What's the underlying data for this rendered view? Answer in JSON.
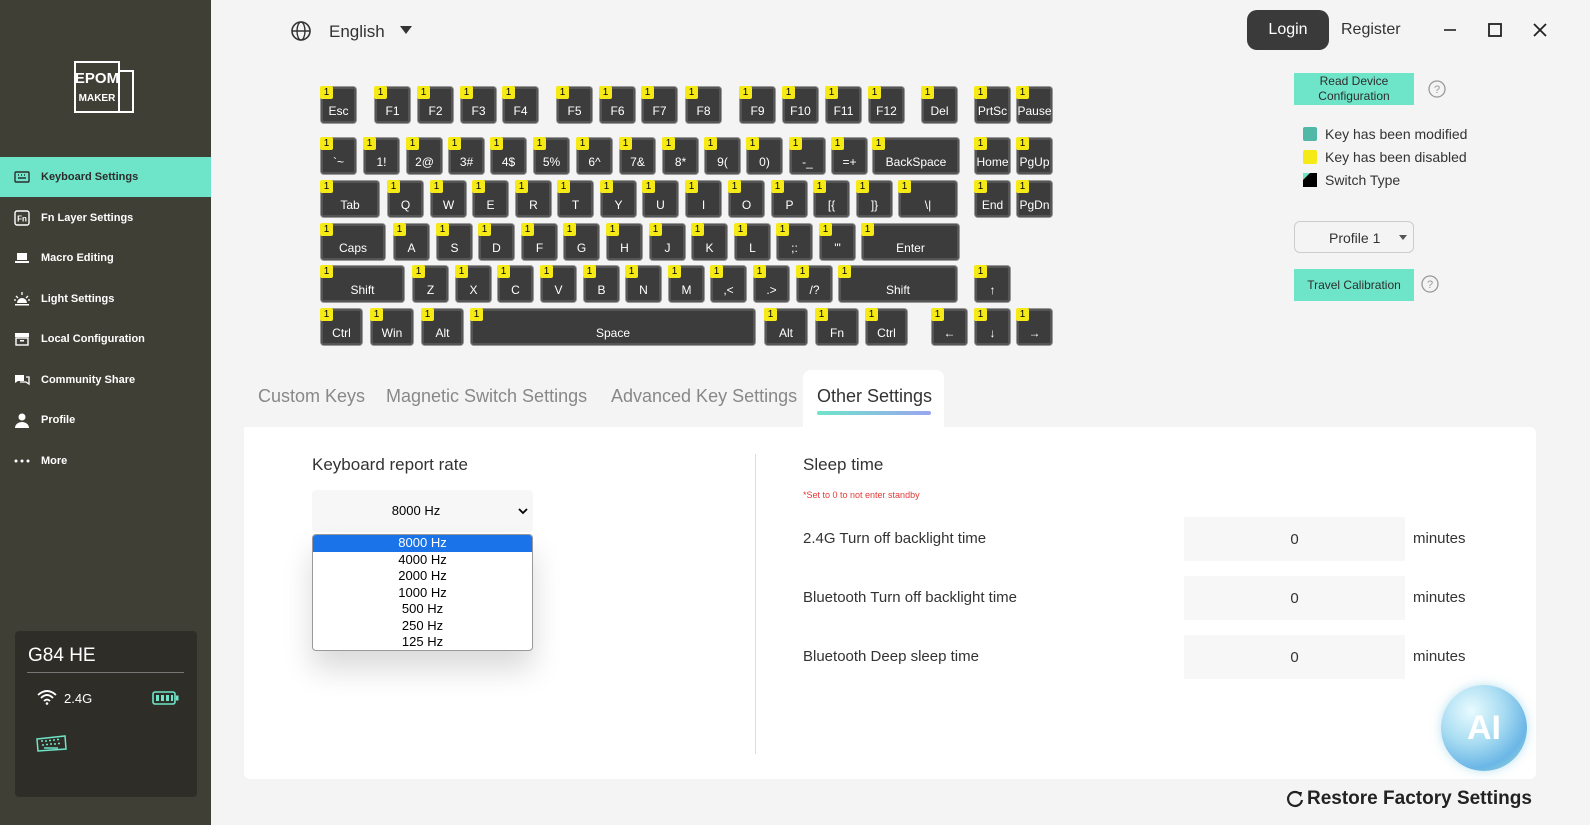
{
  "header": {
    "language": "English",
    "login_label": "Login",
    "register_label": "Register"
  },
  "sidebar": {
    "logo_line1": "EPOM",
    "logo_line2": "MAKER",
    "items": [
      {
        "label": "Keyboard Settings",
        "icon": "keyboard-icon",
        "active": true
      },
      {
        "label": "Fn Layer Settings",
        "icon": "fn-icon"
      },
      {
        "label": "Macro Editing",
        "icon": "laptop-icon"
      },
      {
        "label": "Light Settings",
        "icon": "light-icon"
      },
      {
        "label": "Local Configuration",
        "icon": "box-icon"
      },
      {
        "label": "Community Share",
        "icon": "chat-icon"
      },
      {
        "label": "Profile",
        "icon": "user-icon"
      },
      {
        "label": "More",
        "icon": "dots-icon"
      }
    ],
    "device": {
      "name": "G84 HE",
      "connection": "2.4G"
    }
  },
  "keyboard": {
    "badge": "1",
    "rows": [
      [
        "Esc",
        "F1",
        "F2",
        "F3",
        "F4",
        "F5",
        "F6",
        "F7",
        "F8",
        "F9",
        "F10",
        "F11",
        "F12",
        "Del",
        "PrtSc",
        "Pause"
      ],
      [
        "`~",
        "1!",
        "2@",
        "3#",
        "4$",
        "5%",
        "6^",
        "7&",
        "8*",
        "9(",
        "0)",
        "-_",
        "=+",
        "BackSpace",
        "Home",
        "PgUp"
      ],
      [
        "Tab",
        "Q",
        "W",
        "E",
        "R",
        "T",
        "Y",
        "U",
        "I",
        "O",
        "P",
        "[{",
        "]}",
        "\\|",
        "End",
        "PgDn"
      ],
      [
        "Caps",
        "A",
        "S",
        "D",
        "F",
        "G",
        "H",
        "J",
        "K",
        "L",
        ";:",
        "'\"",
        "Enter"
      ],
      [
        "Shift",
        "Z",
        "X",
        "C",
        "V",
        "B",
        "N",
        "M",
        ",<",
        ".>",
        "/?",
        "Shift",
        "↑"
      ],
      [
        "Ctrl",
        "Win",
        "Alt",
        "Space",
        "Alt",
        "Fn",
        "Ctrl",
        "←",
        "↓",
        "→"
      ]
    ]
  },
  "right_panel": {
    "read_config_label": "Read Device Configuration",
    "legend": [
      {
        "label": "Key has been modified",
        "color": "#4fb8a6"
      },
      {
        "label": "Key has been disabled",
        "color": "#f5ea16"
      },
      {
        "label": "Switch Type",
        "color": "#000000"
      }
    ],
    "profile_value": "Profile 1",
    "travel_label": "Travel Calibration"
  },
  "tabs": [
    {
      "label": "Custom Keys"
    },
    {
      "label": "Magnetic Switch Settings"
    },
    {
      "label": "Advanced Key Settings"
    },
    {
      "label": "Other Settings",
      "active": true
    }
  ],
  "other_settings": {
    "report_rate": {
      "title": "Keyboard report rate",
      "selected": "8000 Hz",
      "options": [
        "8000 Hz",
        "4000 Hz",
        "2000 Hz",
        "1000 Hz",
        "500 Hz",
        "250 Hz",
        "125 Hz"
      ]
    },
    "sleep": {
      "title": "Sleep time",
      "note": "*Set to 0 to not enter standby",
      "rows": [
        {
          "label": "2.4G Turn off backlight time",
          "value": "0",
          "unit": "minutes"
        },
        {
          "label": "Bluetooth Turn off backlight time",
          "value": "0",
          "unit": "minutes"
        },
        {
          "label": "Bluetooth Deep sleep time",
          "value": "0",
          "unit": "minutes"
        }
      ]
    },
    "restore_label": "Restore Factory Settings",
    "ai_label": "AI"
  },
  "colors": {
    "accent": "#6ee5c9",
    "sidebar_bg": "#403f36",
    "key_bg": "#3c3c3c",
    "badge": "#f5ea16"
  }
}
